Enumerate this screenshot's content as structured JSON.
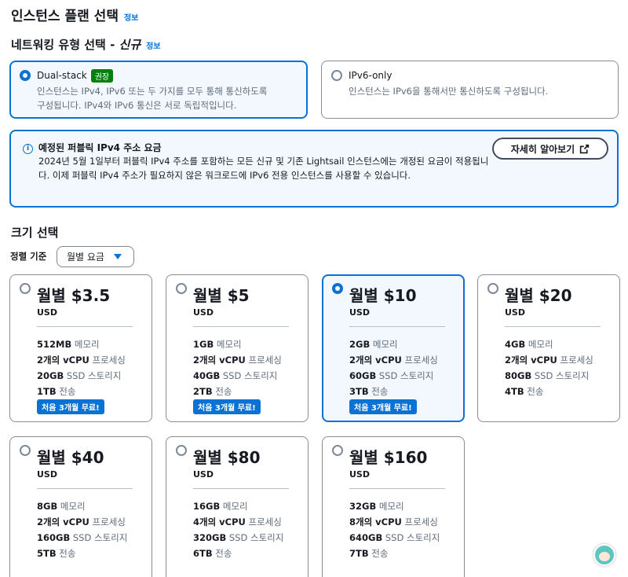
{
  "header": {
    "title": "인스턴스 플랜 선택",
    "info": "정보"
  },
  "network": {
    "title": "네트워킹 유형 선택 - ",
    "title_italic": "신규",
    "info": "정보",
    "options": [
      {
        "label": "Dual-stack",
        "badge": "권장",
        "desc1": "인스턴스는 IPv4, IPv6 또는 두 가지를 모두 통해 통신하도록",
        "desc2": "구성됩니다. IPv4와 IPv6 통신은 서로 독립적입니다.",
        "selected": true
      },
      {
        "label": "IPv6-only",
        "desc1": "인스턴스는 IPv6을 통해서만 통신하도록 구성됩니다.",
        "selected": false
      }
    ]
  },
  "alert": {
    "title": "예정된 퍼블릭 IPv4 주소 요금",
    "body": "2024년 5월 1일부터 퍼블릭 IPv4 주소를 포함하는 모든 신규 및 기존 Lightsail 인스턴스에는 개정된 요금이 적용됩니다. 이제 퍼블릭 IPv4 주소가 필요하지 않은 워크로드에 IPv6 전용 인스턴스를 사용할 수 있습니다.",
    "button": "자세히 알아보기"
  },
  "size": {
    "title": "크기 선택",
    "sort_label": "정렬 기준",
    "sort_value": "월별 요금"
  },
  "plans": [
    {
      "price": "월별 $3.5",
      "currency": "USD",
      "mem": "512MB",
      "mem_u": "메모리",
      "cpu": "2개의 vCPU",
      "cpu_u": "프로세싱",
      "ssd": "20GB",
      "ssd_u": "SSD 스토리지",
      "xfer": "1TB",
      "xfer_u": "전송",
      "promo": "처음 3개월 무료!",
      "selected": false
    },
    {
      "price": "월별 $5",
      "currency": "USD",
      "mem": "1GB",
      "mem_u": "메모리",
      "cpu": "2개의 vCPU",
      "cpu_u": "프로세싱",
      "ssd": "40GB",
      "ssd_u": "SSD 스토리지",
      "xfer": "2TB",
      "xfer_u": "전송",
      "promo": "처음 3개월 무료!",
      "selected": false
    },
    {
      "price": "월별 $10",
      "currency": "USD",
      "mem": "2GB",
      "mem_u": "메모리",
      "cpu": "2개의 vCPU",
      "cpu_u": "프로세싱",
      "ssd": "60GB",
      "ssd_u": "SSD 스토리지",
      "xfer": "3TB",
      "xfer_u": "전송",
      "promo": "처음 3개월 무료!",
      "selected": true
    },
    {
      "price": "월별 $20",
      "currency": "USD",
      "mem": "4GB",
      "mem_u": "메모리",
      "cpu": "2개의 vCPU",
      "cpu_u": "프로세싱",
      "ssd": "80GB",
      "ssd_u": "SSD 스토리지",
      "xfer": "4TB",
      "xfer_u": "전송",
      "selected": false
    },
    {
      "price": "월별 $40",
      "currency": "USD",
      "mem": "8GB",
      "mem_u": "메모리",
      "cpu": "2개의 vCPU",
      "cpu_u": "프로세싱",
      "ssd": "160GB",
      "ssd_u": "SSD 스토리지",
      "xfer": "5TB",
      "xfer_u": "전송",
      "selected": false
    },
    {
      "price": "월별 $80",
      "currency": "USD",
      "mem": "16GB",
      "mem_u": "메모리",
      "cpu": "4개의 vCPU",
      "cpu_u": "프로세싱",
      "ssd": "320GB",
      "ssd_u": "SSD 스토리지",
      "xfer": "6TB",
      "xfer_u": "전송",
      "selected": false
    },
    {
      "price": "월별 $160",
      "currency": "USD",
      "mem": "32GB",
      "mem_u": "메모리",
      "cpu": "8개의 vCPU",
      "cpu_u": "프로세싱",
      "ssd": "640GB",
      "ssd_u": "SSD 스토리지",
      "xfer": "7TB",
      "xfer_u": "전송",
      "selected": false
    }
  ],
  "colors": {
    "accent": "#0972d3",
    "recommended": "#037f0c",
    "selected_bg": "#f2f8fd"
  }
}
